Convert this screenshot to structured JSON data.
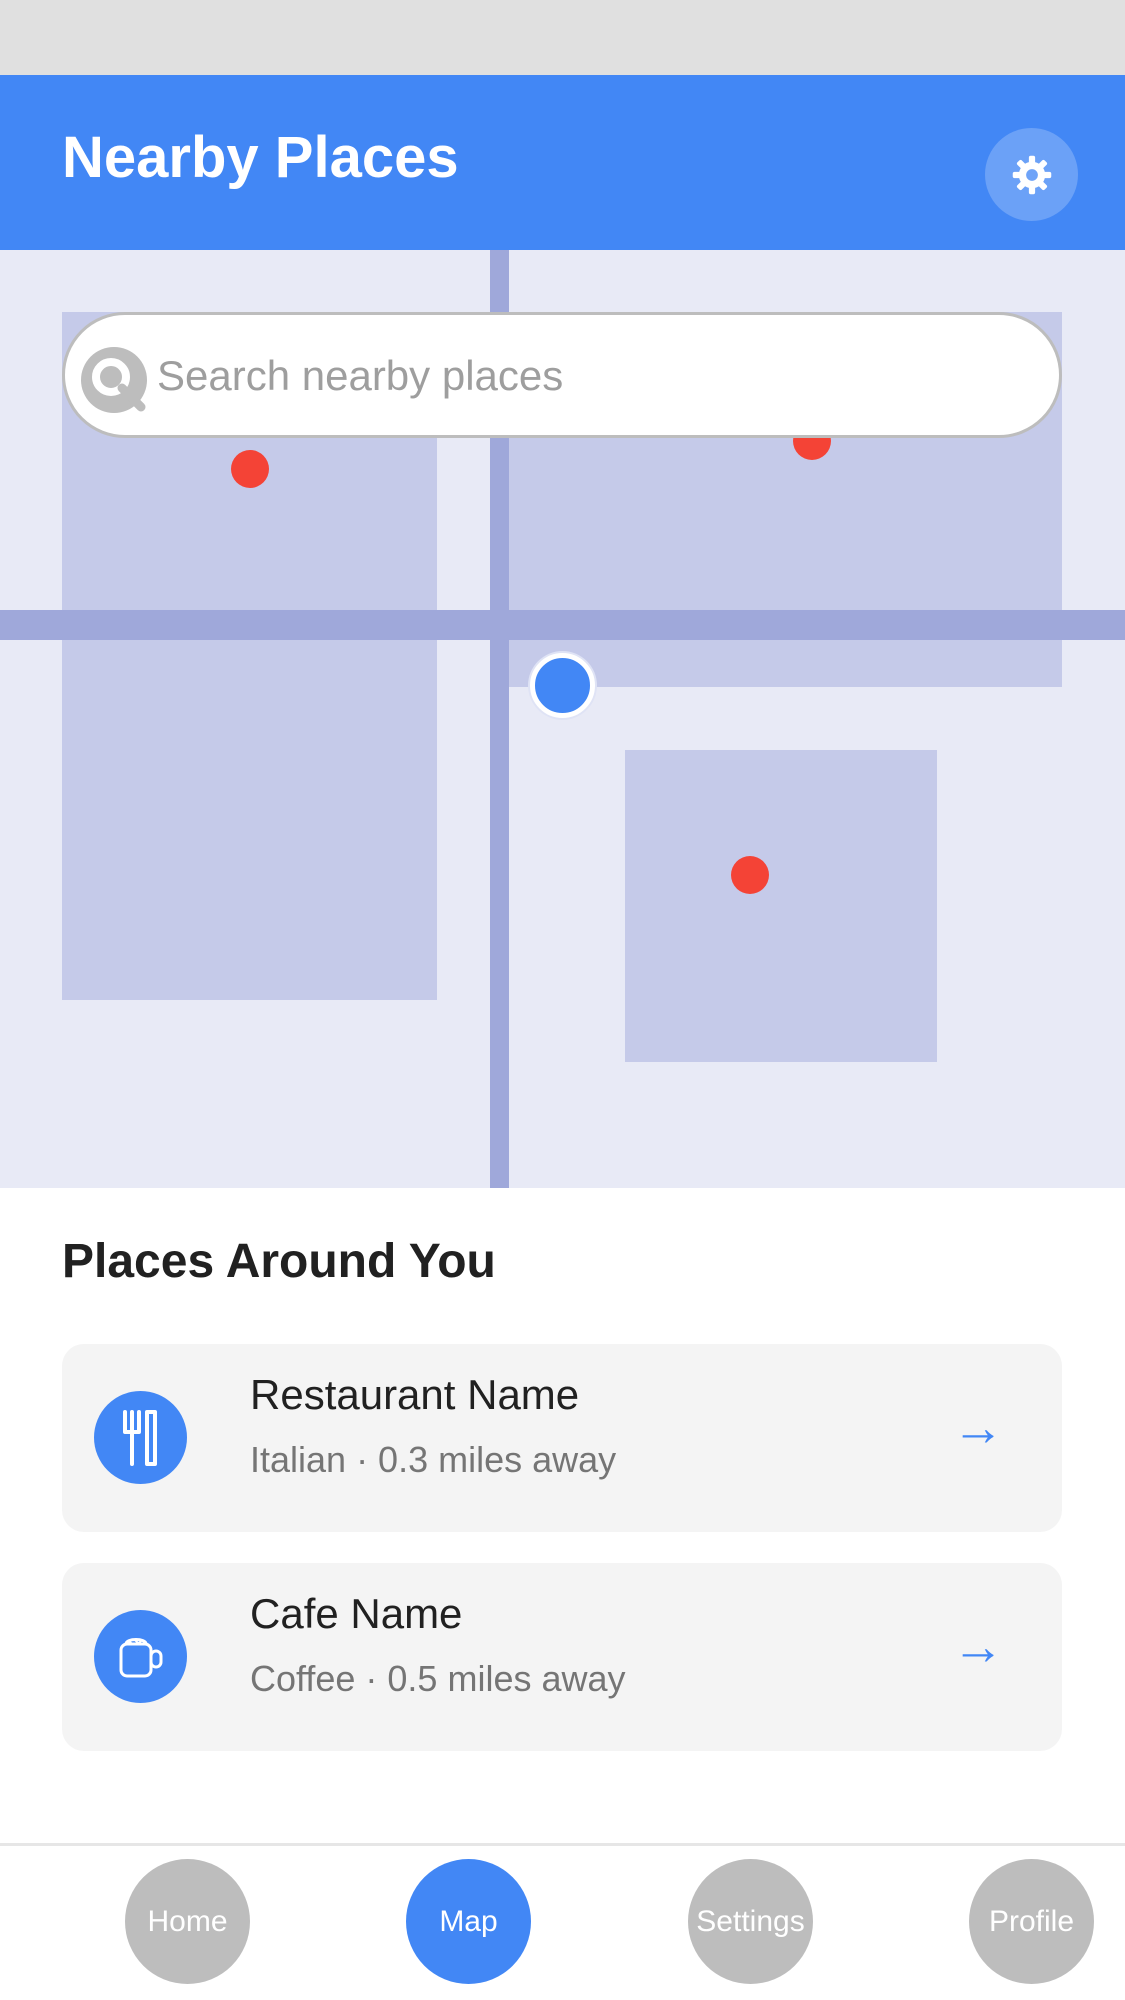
{
  "app_bar": {
    "title": "Nearby Places",
    "settings_icon": "gear-icon"
  },
  "search": {
    "placeholder": "Search nearby places",
    "value": "",
    "icon": "search-icon"
  },
  "map": {
    "user_location_color": "#4287f5",
    "poi_color": "#f44336"
  },
  "places": {
    "title": "Places Around You",
    "items": [
      {
        "name": "Restaurant Name",
        "meta": "Italian · 0.3 miles away",
        "icon": "utensils-icon"
      },
      {
        "name": "Cafe Name",
        "meta": "Coffee · 0.5 miles away",
        "icon": "coffee-cup-icon"
      }
    ],
    "arrow": "→"
  },
  "nav": {
    "items": [
      "Home",
      "Map",
      "Settings",
      "Profile"
    ],
    "active": "Map"
  },
  "colors": {
    "primary": "#4287f5",
    "map_background": "#e8eaf6",
    "map_block": "#c5cae9",
    "map_road": "#9fa8da",
    "inactive": "#bdbdbd"
  }
}
